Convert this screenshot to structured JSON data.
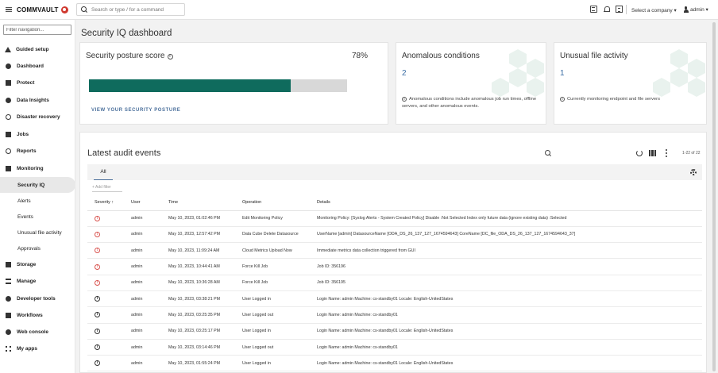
{
  "header": {
    "brand": "COMMVAULT",
    "search_placeholder": "Search or type / for a command",
    "company_selector": "Select a company ▾",
    "user": "admin ▾"
  },
  "sidebar": {
    "filter_placeholder": "Filter navigation...",
    "items": [
      {
        "label": "Guided setup",
        "icon": "wrench-icon"
      },
      {
        "label": "Dashboard",
        "icon": "dashboard-icon"
      },
      {
        "label": "Protect",
        "icon": "shield-icon"
      },
      {
        "label": "Data Insights",
        "icon": "insights-icon"
      },
      {
        "label": "Disaster recovery",
        "icon": "recovery-icon"
      },
      {
        "label": "Jobs",
        "icon": "jobs-icon"
      },
      {
        "label": "Reports",
        "icon": "reports-icon"
      },
      {
        "label": "Monitoring",
        "icon": "monitoring-icon"
      },
      {
        "label": "Security IQ",
        "sub": true,
        "active": true
      },
      {
        "label": "Alerts",
        "sub": true
      },
      {
        "label": "Events",
        "sub": true
      },
      {
        "label": "Unusual file activity",
        "sub": true
      },
      {
        "label": "Approvals",
        "sub": true
      },
      {
        "label": "Storage",
        "icon": "storage-icon"
      },
      {
        "label": "Manage",
        "icon": "manage-icon"
      },
      {
        "label": "Developer tools",
        "icon": "developer-icon"
      },
      {
        "label": "Workflows",
        "icon": "workflow-icon"
      },
      {
        "label": "Web console",
        "icon": "globe-icon"
      },
      {
        "label": "My apps",
        "icon": "apps-icon"
      }
    ]
  },
  "page": {
    "title": "Security IQ dashboard"
  },
  "posture": {
    "title": "Security posture score",
    "value": "78%",
    "fraction": 0.78,
    "link": "VIEW YOUR SECURITY POSTURE"
  },
  "anomalous": {
    "title": "Anomalous conditions",
    "count": "2",
    "note": "Anomalous conditions include anomalous job run times, offline servers, and other anomalous events."
  },
  "unusual": {
    "title": "Unusual file activity",
    "count": "1",
    "note": "Currently monitoring endpoint and file servers"
  },
  "events": {
    "title": "Latest audit events",
    "pager": "1-22 of 22",
    "tab": "All",
    "add_filter": "+ Add filter",
    "columns": [
      "Severity ↑",
      "User",
      "Time",
      "Operation",
      "Details"
    ],
    "rows": [
      {
        "severity": "warning",
        "user": "admin",
        "time": "May 10, 2023, 01:02:46 PM",
        "operation": "Edit Monitoring Policy",
        "details": "Monitoring Policy: [Syslog Alerts - System Created Policy] Disable :Not Selected Index only future data (ignore existing data) :Selected"
      },
      {
        "severity": "warning",
        "user": "admin",
        "time": "May 10, 2023, 12:57:42 PM",
        "operation": "Data Cube Delete Datasource",
        "details": "UserName [admin] DatasourceName [ODA_DS_26_137_127_1674594643] CoreName [DC_file_ODA_DS_26_137_127_1674594643_37]"
      },
      {
        "severity": "warning",
        "user": "admin",
        "time": "May 10, 2023, 11:09:24 AM",
        "operation": "Cloud Metrics Upload Now",
        "details": "Immediate metrics data collection triggered from GUI"
      },
      {
        "severity": "warning",
        "user": "admin",
        "time": "May 10, 2023, 10:44:41 AM",
        "operation": "Force Kill Job",
        "details": "Job ID: 356196"
      },
      {
        "severity": "warning",
        "user": "admin",
        "time": "May 10, 2023, 10:36:28 AM",
        "operation": "Force Kill Job",
        "details": "Job ID: 356195"
      },
      {
        "severity": "info",
        "user": "admin",
        "time": "May 10, 2023, 03:38:21 PM",
        "operation": "User Logged in",
        "details": "Login Name: admin Machine: cs-standby01 Locale: English-UnitedStates"
      },
      {
        "severity": "info",
        "user": "admin",
        "time": "May 10, 2023, 03:25:35 PM",
        "operation": "User Logged out",
        "details": "Login Name: admin Machine: cs-standby01"
      },
      {
        "severity": "info",
        "user": "admin",
        "time": "May 10, 2023, 03:25:17 PM",
        "operation": "User Logged in",
        "details": "Login Name: admin Machine: cs-standby01 Locale: English-UnitedStates"
      },
      {
        "severity": "info",
        "user": "admin",
        "time": "May 10, 2023, 03:14:46 PM",
        "operation": "User Logged out",
        "details": "Login Name: admin Machine: cs-standby01"
      },
      {
        "severity": "info",
        "user": "admin",
        "time": "May 10, 2023, 01:55:24 PM",
        "operation": "User Logged in",
        "details": "Login Name: admin Machine: cs-standby01 Locale: English-UnitedStates"
      }
    ]
  },
  "colors": {
    "accent": "#0f6b5d",
    "link": "#4a6f9b",
    "warning": "#d9534f",
    "brand": "#d0392f"
  }
}
